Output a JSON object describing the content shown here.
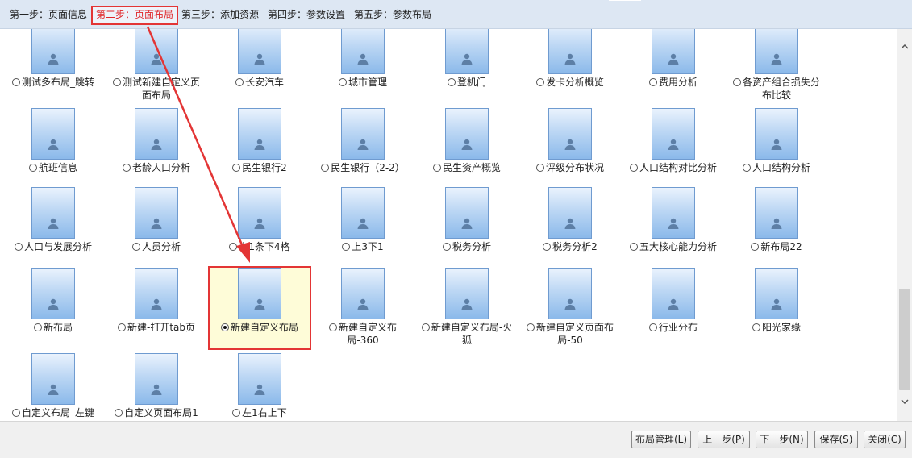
{
  "steps": [
    {
      "label": "第一步：页面信息",
      "active": false
    },
    {
      "label": "第二步：页面布局",
      "active": true
    },
    {
      "label": "第三步：添加资源",
      "active": false
    },
    {
      "label": "第四步：参数设置",
      "active": false
    },
    {
      "label": "第五步：参数布局",
      "active": false
    }
  ],
  "layouts": [
    [
      "测试多布局_跳转",
      "测试新建自定义页面布局",
      "长安汽车",
      "城市管理",
      "登机门",
      "发卡分析概览",
      "费用分析",
      "各资产组合损失分布比较"
    ],
    [
      "航班信息",
      "老龄人口分析",
      "民生银行2",
      "民生银行（2-2）",
      "民生资产概览",
      "评级分布状况",
      "人口结构对比分析",
      "人口结构分析"
    ],
    [
      "人口与发展分析",
      "人员分析",
      "上1条下4格",
      "上3下1",
      "税务分析",
      "税务分析2",
      "五大核心能力分析",
      "新布局22"
    ],
    [
      "新布局",
      "新建-打开tab页",
      "新建自定义布局",
      "新建自定义布局-360",
      "新建自定义布局-火狐",
      "新建自定义页面布局-50",
      "行业分布",
      "阳光家缘"
    ],
    [
      "自定义布局_左键",
      "自定义页面布局1",
      "左1右上下"
    ]
  ],
  "selected_layout": "新建自定义布局",
  "buttons": {
    "layout_manage": "布局管理(L)",
    "prev": "上一步(P)",
    "next": "下一步(N)",
    "save": "保存(S)",
    "close": "关闭(C)"
  },
  "colors": {
    "highlight": "#e33535",
    "selected_bg": "#fefcd8",
    "step_bar": "#dde7f3"
  }
}
